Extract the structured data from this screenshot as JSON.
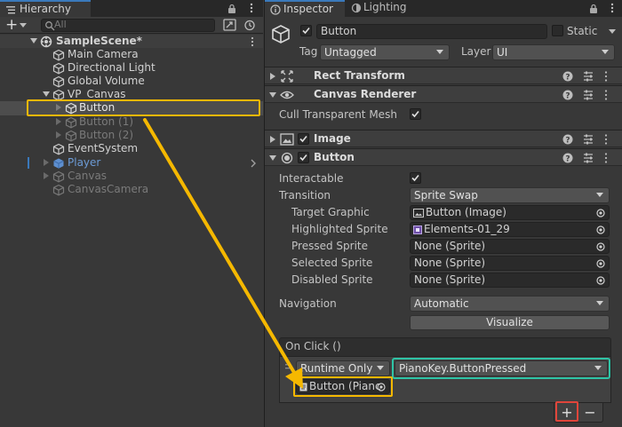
{
  "hierarchy": {
    "tab_label": "Hierarchy",
    "search_placeholder": "All",
    "add_label": "+",
    "items": [
      {
        "label": "SampleScene*",
        "indent": 0,
        "kind": "scene"
      },
      {
        "label": "Main Camera",
        "indent": 1,
        "kind": "object"
      },
      {
        "label": "Directional Light",
        "indent": 1,
        "kind": "object"
      },
      {
        "label": "Global Volume",
        "indent": 1,
        "kind": "object"
      },
      {
        "label": "VP_Canvas",
        "indent": 1,
        "kind": "object"
      },
      {
        "label": "Button",
        "indent": 2,
        "kind": "object"
      },
      {
        "label": "Button (1)",
        "indent": 2,
        "kind": "object"
      },
      {
        "label": "Button (2)",
        "indent": 2,
        "kind": "object"
      },
      {
        "label": "EventSystem",
        "indent": 1,
        "kind": "object"
      },
      {
        "label": "Player",
        "indent": 1,
        "kind": "prefab"
      },
      {
        "label": "Canvas",
        "indent": 1,
        "kind": "object"
      },
      {
        "label": "CanvasCamera",
        "indent": 1,
        "kind": "object"
      }
    ]
  },
  "inspector": {
    "tab_inspector": "Inspector",
    "tab_lighting": "Lighting",
    "object_name": "Button",
    "static_label": "Static",
    "tag_label": "Tag",
    "tag_value": "Untagged",
    "layer_label": "Layer",
    "layer_value": "UI",
    "components": {
      "rect_transform": "Rect Transform",
      "canvas_renderer": "Canvas Renderer",
      "cull_label": "Cull Transparent Mesh",
      "image": "Image",
      "button": "Button"
    },
    "button": {
      "interactable_label": "Interactable",
      "transition_label": "Transition",
      "transition_value": "Sprite Swap",
      "target_graphic_label": "Target Graphic",
      "target_graphic_value": "Button (Image)",
      "highlighted_label": "Highlighted Sprite",
      "highlighted_value": "Elements-01_29",
      "pressed_label": "Pressed Sprite",
      "pressed_value": "None (Sprite)",
      "selected_label": "Selected Sprite",
      "selected_value": "None (Sprite)",
      "disabled_label": "Disabled Sprite",
      "disabled_value": "None (Sprite)",
      "navigation_label": "Navigation",
      "navigation_value": "Automatic",
      "visualize_label": "Visualize"
    },
    "onclick": {
      "title": "On Click ()",
      "runtime_value": "Runtime Only",
      "function_value": "PianoKey.ButtonPressed",
      "object_value": "Button (Pianc",
      "add_label": "+",
      "remove_label": "−"
    }
  },
  "colors": {
    "highlight_outline": "#f5b800",
    "function_outline": "#2ec4a6",
    "add_outline": "#e0453a",
    "arrow": "#f5b800",
    "accent_blue": "#3a79bb"
  }
}
